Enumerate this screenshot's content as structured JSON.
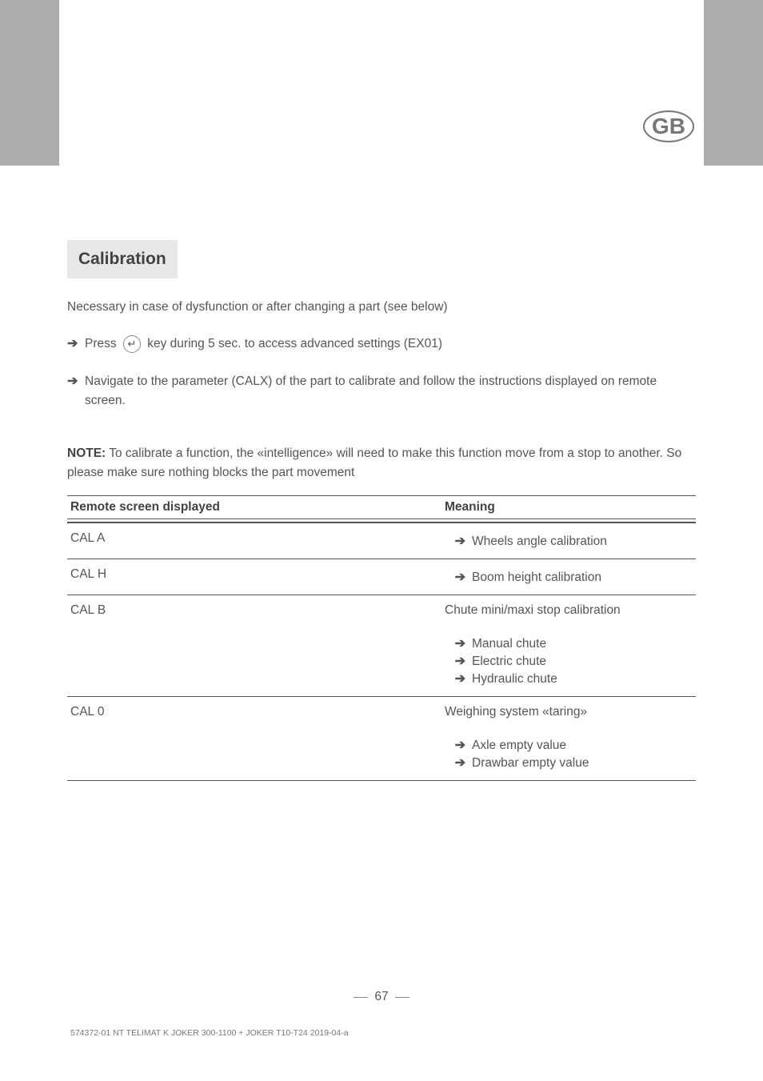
{
  "badge": {
    "label": "GB"
  },
  "section": {
    "title": "Calibration"
  },
  "intro": "Necessary in case of dysfunction or after changing a part (see below)",
  "step1": {
    "pre": "Press ",
    "post": " key during 5 sec. to access advanced settings (EX01)"
  },
  "step2": "Navigate to the parameter (CALX) of the part to calibrate and follow the instructions displayed on remote screen.",
  "note": {
    "label": "NOTE:",
    "body": " To calibrate a function, the «intelligence» will need to make this function move from a stop to another. So please make sure nothing blocks the part movement"
  },
  "table": {
    "headers": {
      "c1": "Remote screen displayed",
      "c2": "Meaning"
    },
    "rows": [
      {
        "c1": "CAL A",
        "c2_arrow": true,
        "c2": " Wheels angle calibration"
      },
      {
        "c1": "CAL H",
        "c2_arrow": true,
        "c2": " Boom height calibration"
      },
      {
        "c1": "CAL B",
        "c2_pre": "Chute mini/maxi stop calibration",
        "group": [
          " Manual chute",
          " Electric chute",
          " Hydraulic chute"
        ]
      },
      {
        "c1": "CAL 0",
        "c2_pre": "Weighing system «taring»",
        "group2": [
          " Axle empty value",
          " Drawbar empty value"
        ]
      }
    ]
  },
  "page": {
    "num": "67"
  },
  "doc_code": "574372-01 NT TELIMAT K JOKER 300-1100 + JOKER T10-T24 2019-04-a"
}
